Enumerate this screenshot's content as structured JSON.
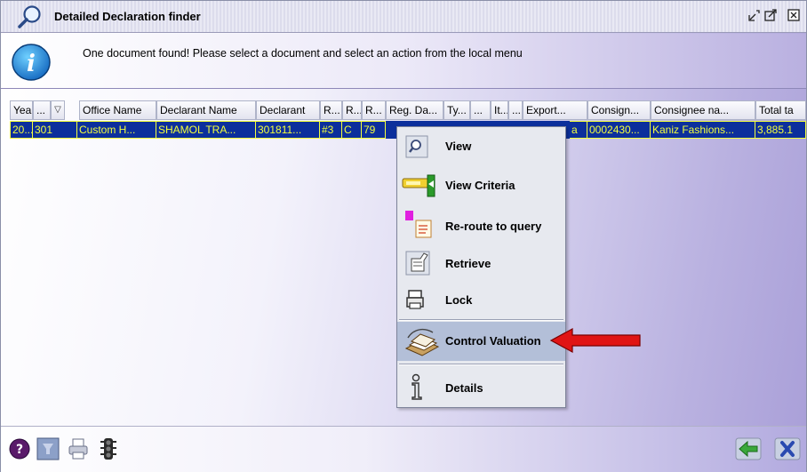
{
  "window": {
    "title": "Detailed Declaration finder"
  },
  "message": {
    "text": "One document found! Please select a document and select an action from the local menu"
  },
  "table": {
    "columns": [
      "Year",
      "...",
      "",
      "Office Name",
      "Declarant Name",
      "Declarant",
      "R...",
      "R...",
      "R...",
      "Reg. Da...",
      "Ty...",
      "...",
      "It...",
      "...",
      "Export...",
      "Consign...",
      "Consignee na...",
      "Total ta"
    ],
    "rows": [
      [
        "20...",
        "301",
        "Custom H...",
        "SHAMOL TRA...",
        "301811...",
        "#3",
        "C",
        "79",
        "",
        "",
        "",
        "",
        "",
        "a",
        "0002430...",
        "Kaniz Fashions...",
        "3,885.1"
      ]
    ]
  },
  "context_menu": {
    "items": [
      {
        "label": "View",
        "icon": "view-icon"
      },
      {
        "label": "View Criteria",
        "icon": "view-criteria-icon"
      },
      {
        "label": "Re-route to query",
        "icon": "reroute-icon"
      },
      {
        "label": "Retrieve",
        "icon": "retrieve-icon"
      },
      {
        "label": "Lock",
        "icon": "lock-icon"
      },
      {
        "label": "Control Valuation",
        "icon": "control-valuation-icon",
        "highlighted": true
      },
      {
        "label": "Details",
        "icon": "details-icon"
      }
    ]
  },
  "colors": {
    "selected_row_bg": "#0c2f9c",
    "selected_row_text": "#f4ff3c",
    "annotation_arrow": "#e01414"
  },
  "bottom_toolbar": {
    "buttons": [
      "help-icon",
      "filter-icon",
      "print-icon",
      "traffic-light-icon",
      "back-arrow-icon",
      "close-x-icon"
    ]
  }
}
